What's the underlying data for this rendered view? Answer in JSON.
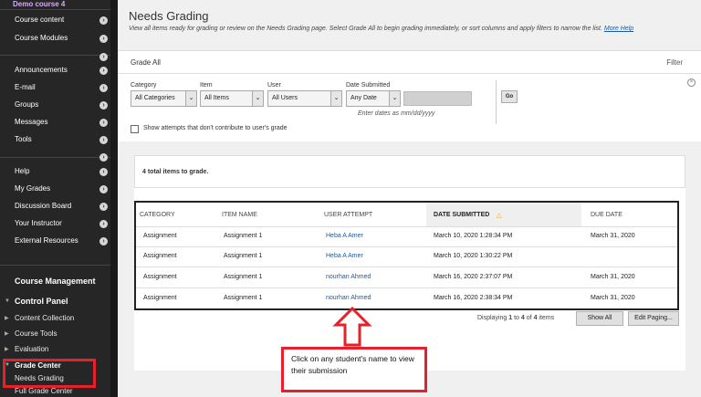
{
  "sidebar": {
    "course_title": "Demo course 4",
    "group1": [
      "Course content",
      "Course Modules"
    ],
    "group2": [
      "Announcements",
      "E-mail",
      "Groups",
      "Messages",
      "Tools"
    ],
    "group3": [
      "Help",
      "My Grades",
      "Discussion Board",
      "Your Instructor",
      "External Resources"
    ],
    "course_management": "Course Management",
    "control_panel": "Control Panel",
    "cp_items": [
      "Content Collection",
      "Course Tools",
      "Evaluation"
    ],
    "grade_center": "Grade Center",
    "grade_center_items": [
      "Needs Grading",
      "Full Grade Center"
    ]
  },
  "page": {
    "title": "Needs Grading",
    "description": "View all items ready for grading or review on the Needs Grading page. Select Grade All to begin grading immediately, or sort columns and apply filters to narrow the list.",
    "more_help": "More Help",
    "grade_all": "Grade All",
    "filter": "Filter"
  },
  "filters": {
    "category_label": "Category",
    "category_value": "All Categories",
    "item_label": "Item",
    "item_value": "All Items",
    "user_label": "User",
    "user_value": "All Users",
    "date_label": "Date Submitted",
    "date_value": "Any Date",
    "go": "Go",
    "date_hint": "Enter dates as mm/dd/yyyy",
    "show_attempts": "Show attempts that don't contribute to user's grade"
  },
  "table": {
    "total": "4 total items to grade.",
    "headers": [
      "CATEGORY",
      "ITEM NAME",
      "USER ATTEMPT",
      "DATE SUBMITTED",
      "DUE DATE"
    ],
    "rows": [
      [
        "Assignment",
        "Assignment 1",
        "Heba A Amer",
        "March 10, 2020 1:28:34 PM",
        "March 31, 2020"
      ],
      [
        "Assignment",
        "Assignment 1",
        "Heba A Amer",
        "March 10, 2020 1:30:22 PM",
        ""
      ],
      [
        "Assignment",
        "Assignment 1",
        "nourhan Ahmed",
        "March 16, 2020 2:37:07 PM",
        "March 31, 2020"
      ],
      [
        "Assignment",
        "Assignment 1",
        "nourhan Ahmed",
        "March 16, 2020 2:38:34 PM",
        "March 31, 2020"
      ]
    ],
    "displaying_prefix": "Displaying",
    "displaying_from": "1",
    "displaying_to_word": "to",
    "displaying_to": "4",
    "displaying_of_word": "of",
    "displaying_total": "4",
    "displaying_suffix": "items",
    "show_all": "Show All",
    "edit_paging": "Edit Paging..."
  },
  "annotation": {
    "callout": "Click on any student's name to view their submission"
  },
  "colors": {
    "sidebar_bg": "#262626",
    "highlight_red": "#e8202a",
    "link_blue": "#1a5a9e"
  }
}
